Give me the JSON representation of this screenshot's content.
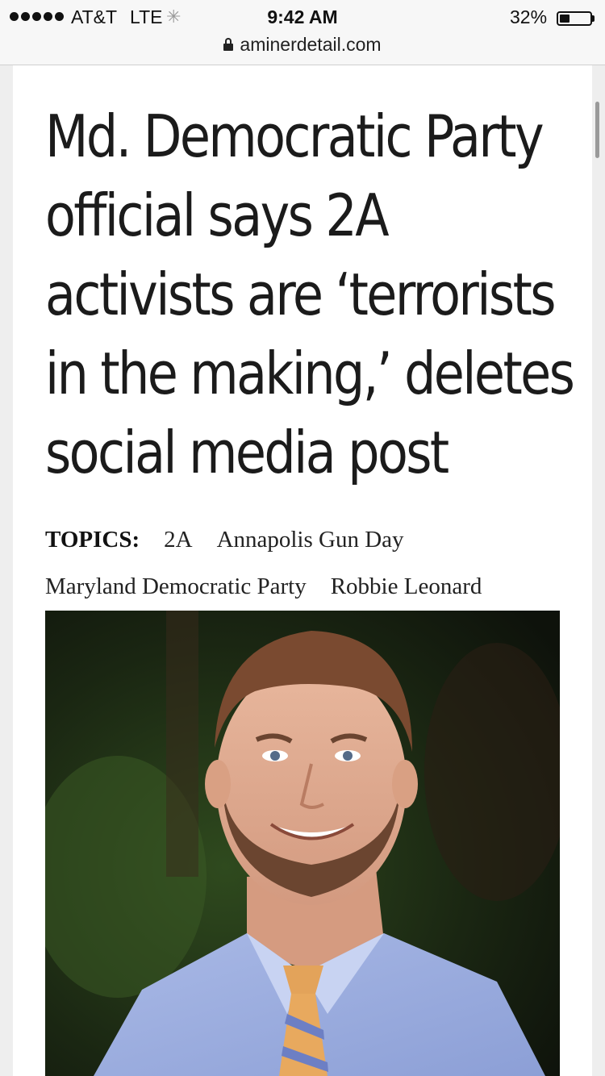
{
  "status_bar": {
    "signal_dots": 5,
    "carrier": "AT&T",
    "network": "LTE",
    "time": "9:42 AM",
    "battery_percent": "32%",
    "battery_level": 0.32
  },
  "browser": {
    "url": "aminerdetail.com"
  },
  "article": {
    "headline_lines": [
      "Md. Democratic Party",
      "official says 2A",
      "activists are ‘terrorists",
      "in the making,’ deletes",
      "social media post"
    ],
    "topics_label": "TOPICS:",
    "topics": [
      "2A",
      "Annapolis Gun Day",
      "Maryland Democratic Party",
      "Robbie Leonard"
    ]
  },
  "icons": {
    "lock": "lock-icon",
    "loading": "activity-spinner-icon",
    "battery": "battery-icon"
  },
  "colors": {
    "headline": "#1b1b1b",
    "page_bg": "#ffffff",
    "chrome_bg": "#f7f7f7"
  }
}
